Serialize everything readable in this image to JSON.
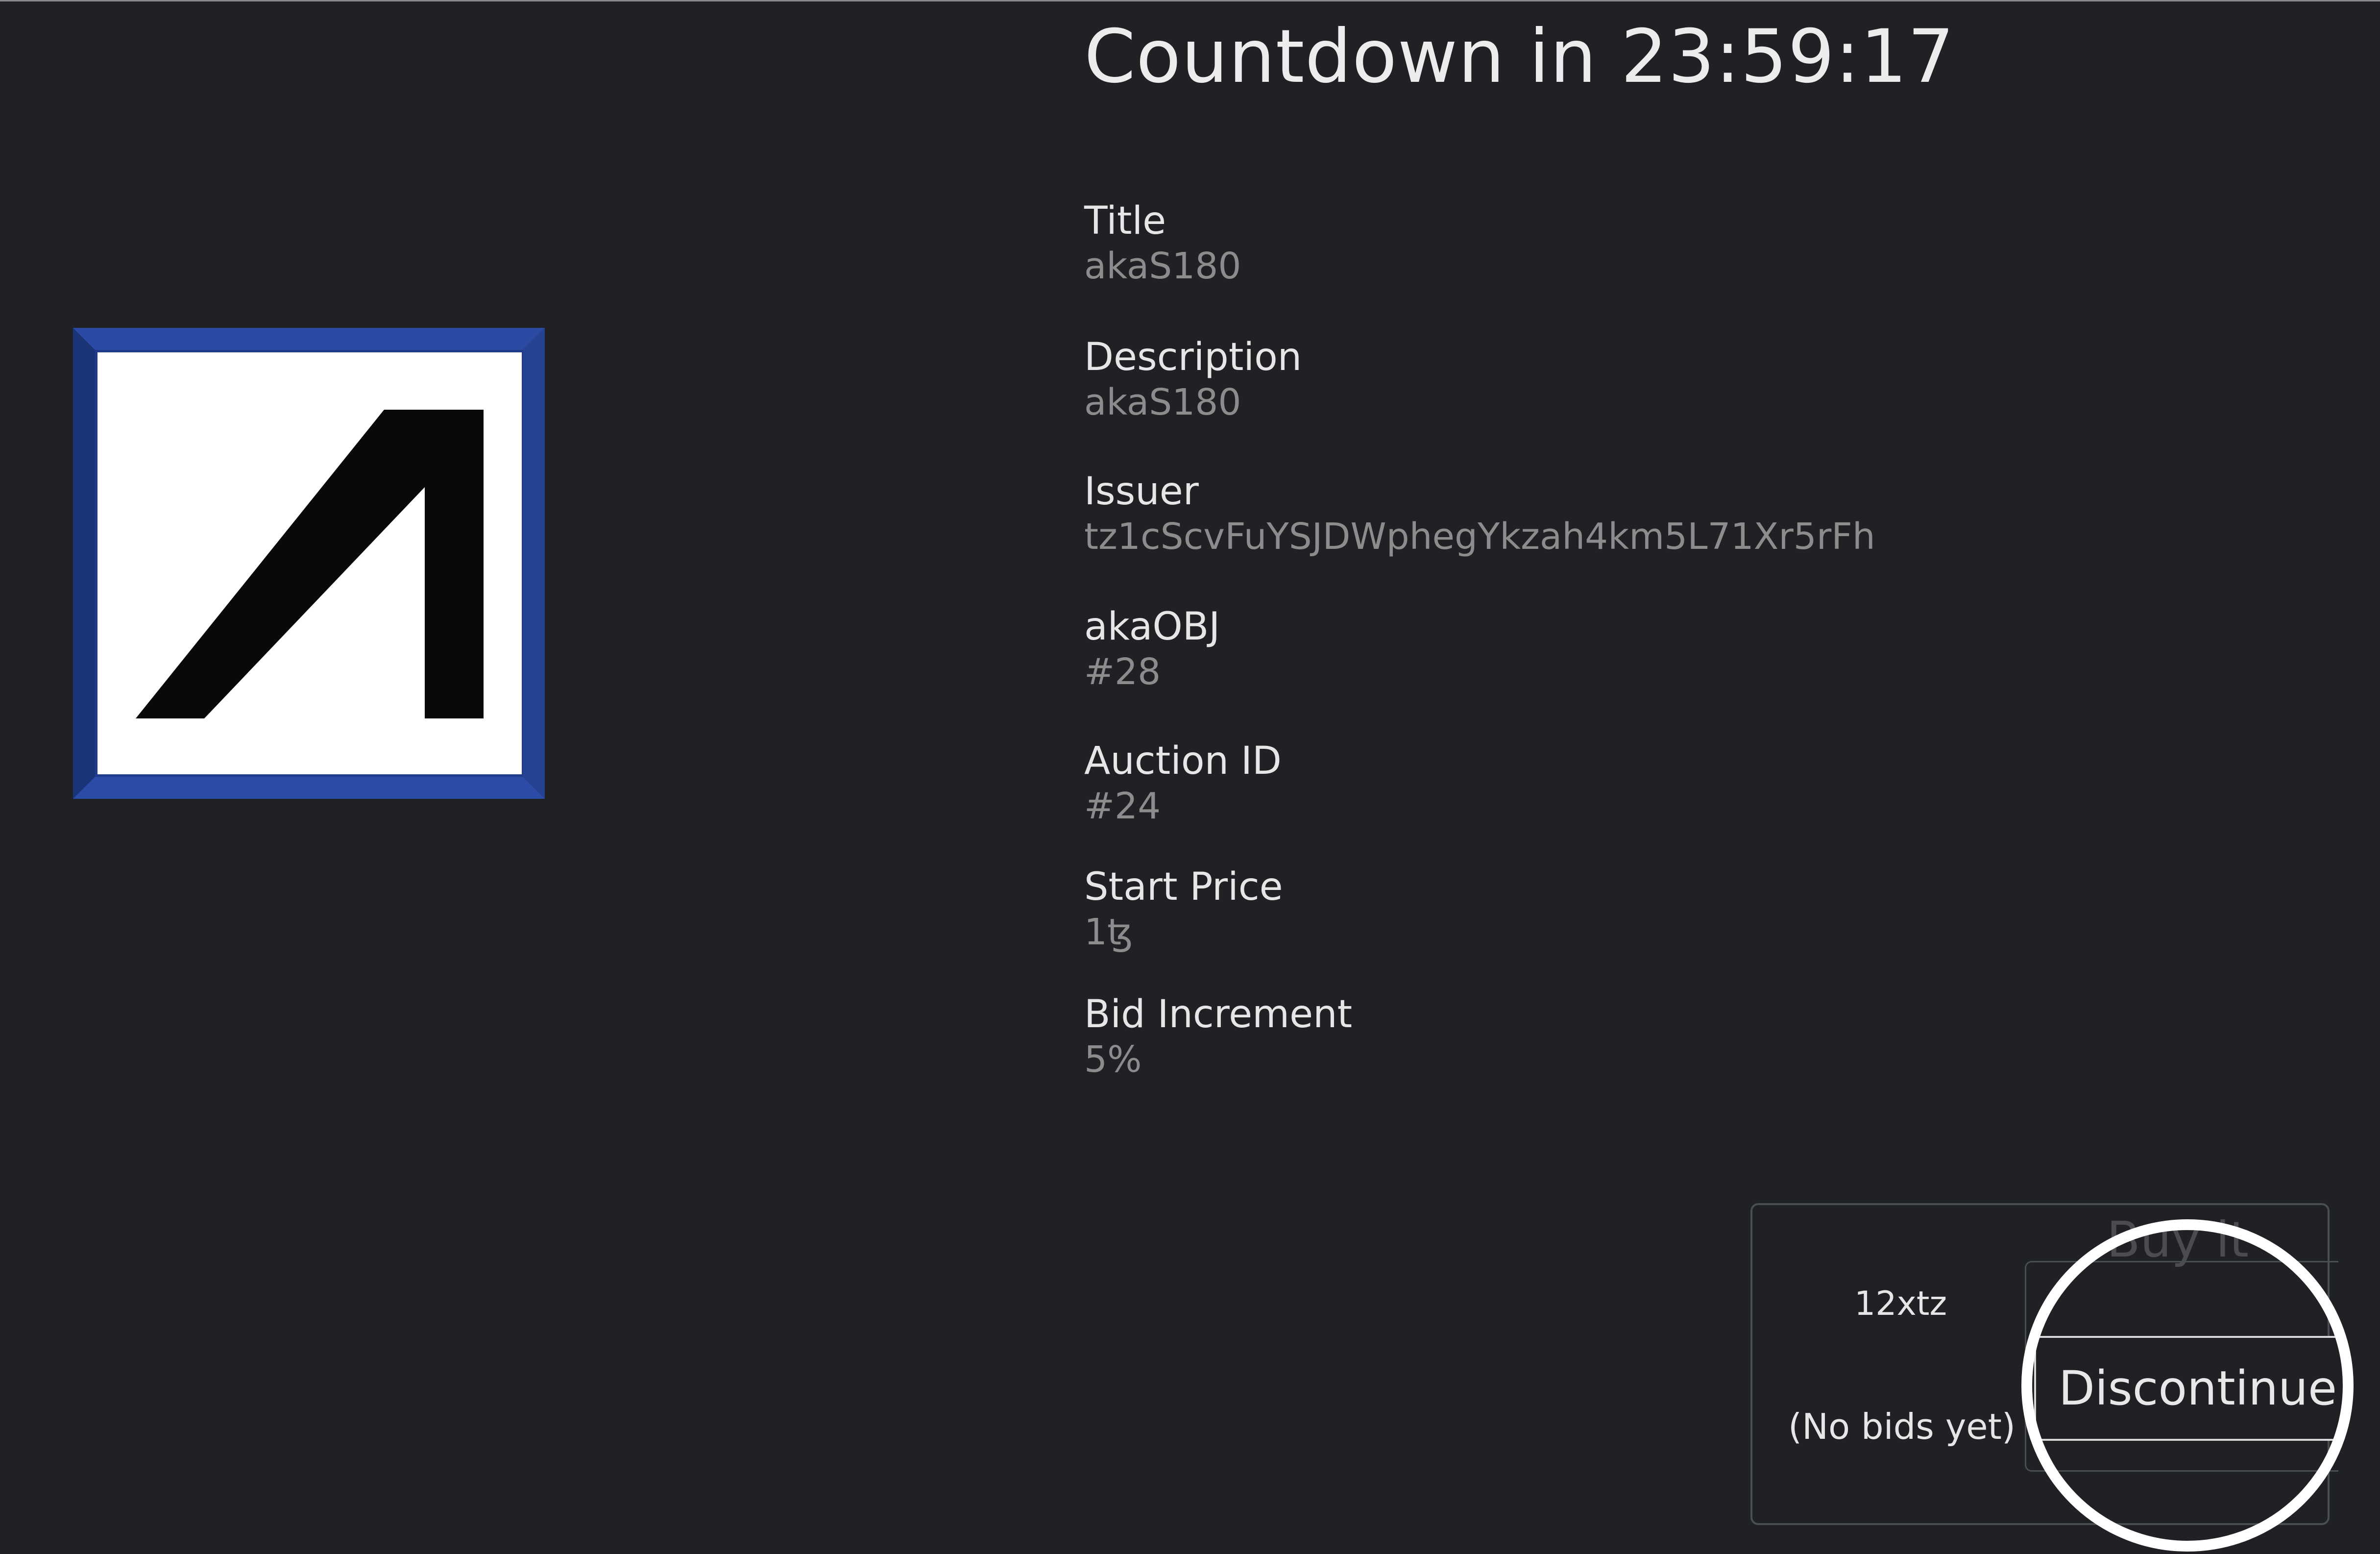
{
  "auction": {
    "countdown_prefix": "Countdown in",
    "countdown_time": "23:59:17"
  },
  "details": {
    "title_label": "Title",
    "title_value": "akaS180",
    "description_label": "Description",
    "description_value": "akaS180",
    "issuer_label": "Issuer",
    "issuer_value": "tz1cScvFuYSJDWphegYkzah4km5L71Xr5rFh",
    "obj_label": "akaOBJ",
    "obj_value": "#28",
    "auction_id_label": "Auction ID",
    "auction_id_value": "#24",
    "start_price_label": "Start Price",
    "start_price_value": "1ꜩ",
    "bid_increment_label": "Bid Increment",
    "bid_increment_value": "5%"
  },
  "bid": {
    "price": "12xtz",
    "status": "(No bids yet)",
    "buy_now_ghost": "Buy it now",
    "discontinue_label": "Discontinue"
  },
  "colors": {
    "background": "#202124",
    "artwork_frame": "#1f3c8c",
    "artwork_fill": "#ffffff",
    "artwork_mark": "#0a0908",
    "highlight_ring": "#ffffff"
  },
  "icons": {
    "artwork": "aka-logo-mark"
  }
}
